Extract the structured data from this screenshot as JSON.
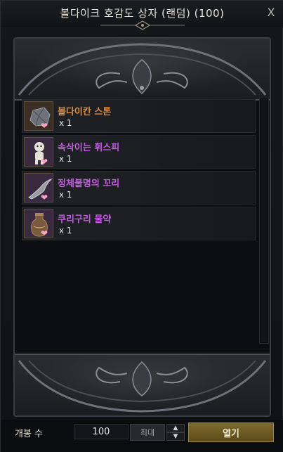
{
  "window": {
    "title": "볼다이크 호감도 상자 (랜덤) (100)",
    "close_label": "X"
  },
  "items": [
    {
      "name": "볼다이칸 스톤",
      "qty": "x 1",
      "name_color": "#e08b3a",
      "icon": "stone-icon"
    },
    {
      "name": "속삭이는 휘스피",
      "qty": "x 1",
      "name_color": "#c35be2",
      "icon": "doll-icon"
    },
    {
      "name": "정체불명의 꼬리",
      "qty": "x 1",
      "name_color": "#c35be2",
      "icon": "tail-icon"
    },
    {
      "name": "쿠리구리 물약",
      "qty": "x 1",
      "name_color": "#c35be2",
      "icon": "potion-icon"
    }
  ],
  "controls": {
    "open_count_label": "개봉 수",
    "count_value": "100",
    "max_label": "최대",
    "up_symbol": "▲",
    "down_symbol": "▼",
    "open_label": "열기"
  },
  "colors": {
    "rare": "#e08b3a",
    "epic": "#c35be2",
    "open_button": "#7d6a2c"
  }
}
